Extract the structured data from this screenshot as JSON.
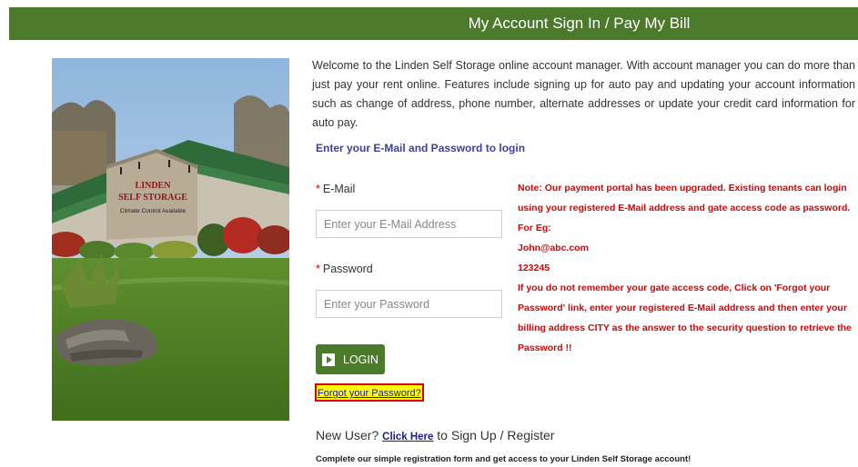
{
  "header": {
    "title": "My Account Sign In / Pay My Bill"
  },
  "photo": {
    "sign_line1": "LINDEN",
    "sign_line2": "SELF STORAGE",
    "sign_line3": "Climate Control Available"
  },
  "intro": "Welcome to the Linden Self Storage online account manager. With account manager you can do more than just pay your rent online. Features include signing up for auto pay and updating your account information such as change of address, phone number, alternate addresses or update your credit card information for auto pay.",
  "login": {
    "heading": "Enter your E-Mail and Password to login",
    "required_mark": "*",
    "email_label": "E-Mail",
    "email_placeholder": "Enter your E-Mail Address",
    "password_label": "Password",
    "password_placeholder": "Enter your Password",
    "login_button": "LOGIN",
    "forgot_link": "Forgot your Password?"
  },
  "note": {
    "lines": [
      "Note: Our payment portal has been upgraded. Existing tenants can login",
      "using your registered E-Mail address and gate access code as password.",
      "For Eg:",
      "John@abc.com",
      "123245",
      "If you do not remember your gate access code, Click on 'Forgot your",
      "Password' link, enter your registered E-Mail address and then enter your",
      "billing address CITY as the answer to the security question to retrieve the",
      "Password !!"
    ]
  },
  "signup": {
    "prefix": "New User?",
    "link": "Click Here",
    "suffix": "to Sign Up / Register",
    "description": "Complete our simple registration form and get access to your Linden Self Storage account!"
  },
  "colors": {
    "brand_green": "#4b7a2b",
    "note_red": "#e00000",
    "heading_blue": "#3f3fa0"
  }
}
